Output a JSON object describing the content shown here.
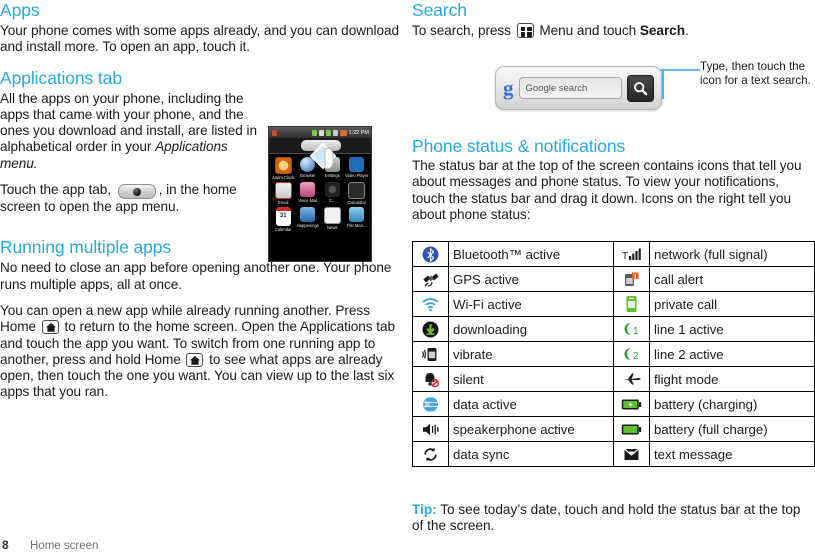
{
  "left_column": {
    "sections": [
      {
        "heading": "Apps",
        "paragraphs": [
          "Your phone comes with some apps already, and you can download and install more. To open an app, touch it."
        ]
      },
      {
        "heading": "Applications tab",
        "p1_a": "All the apps on your phone, including the apps that came with your phone, and the ones you download and install, are listed in alphabetical order in your ",
        "p1_italic": "Applications menu.",
        "p2_a": "Touch the app tab, ",
        "p2_b": ", in the home screen to open the app menu."
      },
      {
        "heading": "Running multiple apps",
        "p1": "No need to close an app before opening another one. Your phone runs multiple apps, all at once.",
        "p2_a": "You can open a new app while already running another. Press Home ",
        "p2_b": " to return to the home screen. Open the Applications tab and touch the app you want. To switch from one running app to another, press and hold Home ",
        "p2_c": " to see what apps are already open, then touch the one you want. You can view up to the last six apps that you ran."
      }
    ]
  },
  "phone_screenshot": {
    "status_bar_time": "1:22 PM",
    "apps": [
      "Alarm Clock",
      "Browser",
      "Settings",
      "Video Player",
      "Email",
      "Voice Mail",
      "C...",
      "Calculator",
      "Calendar",
      "Happenings",
      "News",
      "File Man..."
    ],
    "calendar_day": "31"
  },
  "right_column": {
    "search_section": {
      "heading": "Search",
      "intro_a": "To search, press ",
      "intro_b": " Menu and touch ",
      "intro_bold": "Search",
      "intro_c": ".",
      "widget": {
        "logo": "g",
        "placeholder": "Google search",
        "search_icon": "search-icon"
      },
      "callout": "Type, then touch the icon for a text search."
    },
    "status_section": {
      "heading": "Phone status & notifications",
      "paragraph": "The status bar at the top of the screen contains icons that tell you about messages and phone status. To view your notifications, touch the status bar and drag it down. Icons on the right tell you about phone status:"
    },
    "status_table": {
      "rows": [
        {
          "left_icon": "bluetooth-icon",
          "left_label": "Bluetooth™ active",
          "right_icon": "signal-bars-icon",
          "right_label": "network (full signal)"
        },
        {
          "left_icon": "gps-satellite-icon",
          "left_label": "GPS active",
          "right_icon": "call-alert-icon",
          "right_label": "call alert"
        },
        {
          "left_icon": "wifi-icon",
          "left_label": "Wi-Fi active",
          "right_icon": "private-call-icon",
          "right_label": "private call"
        },
        {
          "left_icon": "download-icon",
          "left_label": "downloading",
          "right_icon": "line-1-icon",
          "right_label": "line 1 active"
        },
        {
          "left_icon": "vibrate-icon",
          "left_label": "vibrate",
          "right_icon": "line-2-icon",
          "right_label": "line 2 active"
        },
        {
          "left_icon": "silent-bell-icon",
          "left_label": "silent",
          "right_icon": "airplane-icon",
          "right_label": "flight mode"
        },
        {
          "left_icon": "data-active-icon",
          "left_label": "data active",
          "right_icon": "battery-charging-icon",
          "right_label": "battery (charging)"
        },
        {
          "left_icon": "speakerphone-icon",
          "left_label": "speakerphone active",
          "right_icon": "battery-full-icon",
          "right_label": "battery (full charge)"
        },
        {
          "left_icon": "data-sync-icon",
          "left_label": "data sync",
          "right_icon": "text-message-icon",
          "right_label": "text message"
        }
      ]
    },
    "tip": {
      "label": "Tip:",
      "text": " To see today’s date, touch and hold the status bar at the top of the screen."
    }
  },
  "footer": {
    "page_number": "8",
    "chapter": "Home screen"
  }
}
